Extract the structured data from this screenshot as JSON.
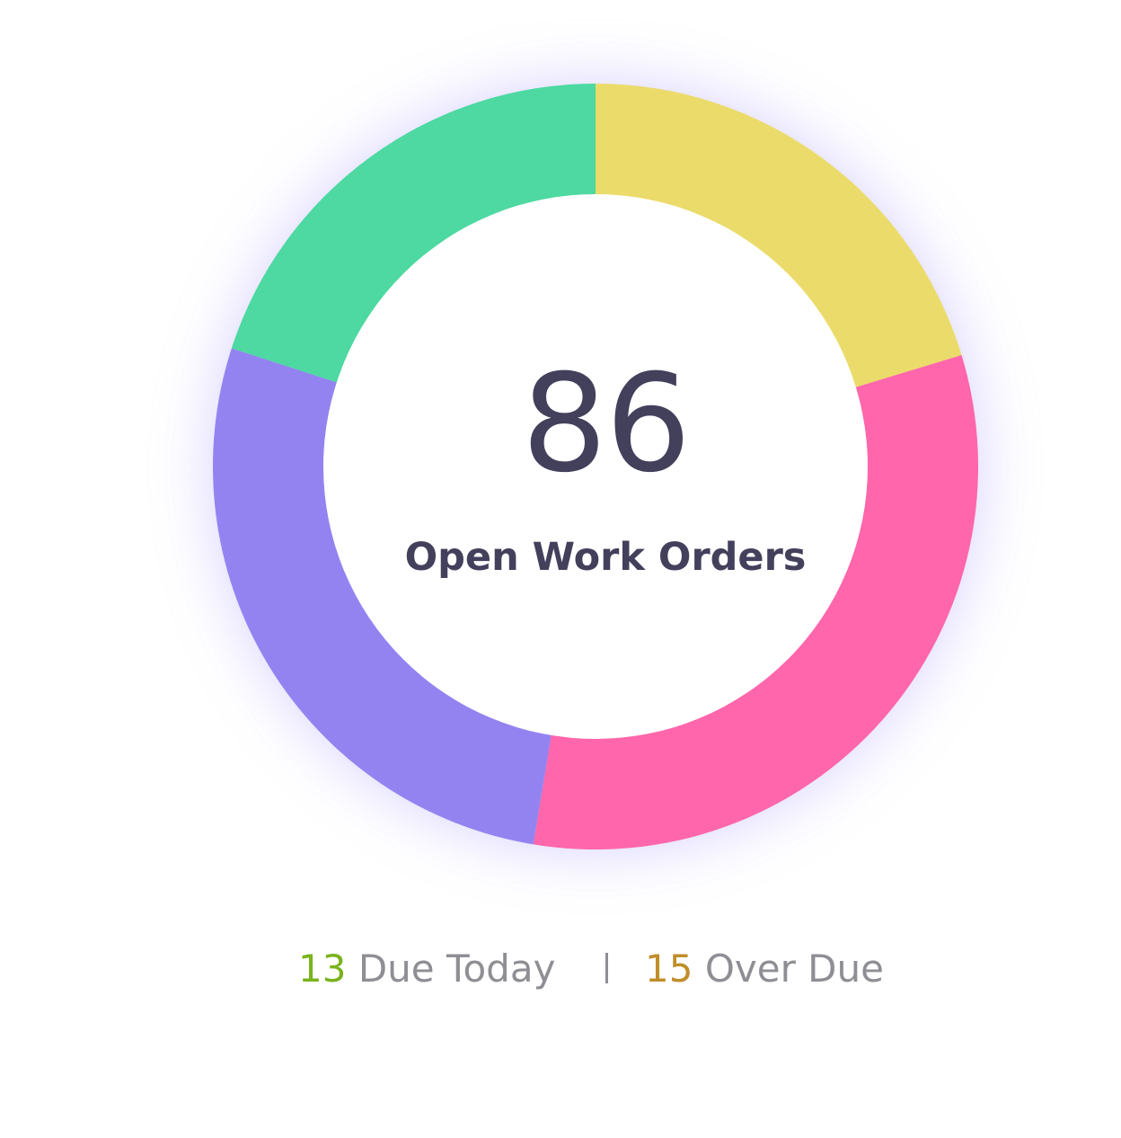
{
  "chart_data": {
    "type": "pie",
    "style": "donut",
    "categories": [
      "",
      "",
      "",
      ""
    ],
    "values": [
      0.203,
      0.323,
      0.274,
      0.2
    ],
    "colors": [
      "#ebdb6a",
      "#ff66ab",
      "#9383f1",
      "#4dd9a1"
    ],
    "start_angle_deg": 0,
    "direction": "clockwise",
    "center_value": "86",
    "center_label": "Open Work Orders",
    "legend": "none"
  },
  "summary": {
    "due_today": {
      "count": "13",
      "label": "Due Today",
      "color": "#7ab31d"
    },
    "divider": "|",
    "over_due": {
      "count": "15",
      "label": "Over Due",
      "color": "#c08e2a"
    }
  },
  "theme": {
    "text_color": "#43405c",
    "muted_color": "#8e8e94",
    "glow_color": "#b9b0ff"
  }
}
